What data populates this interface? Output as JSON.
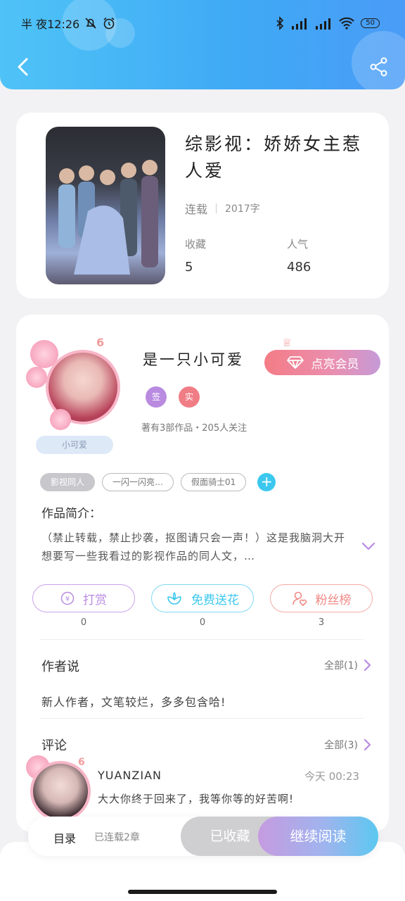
{
  "status_bar": {
    "time": "半 夜12:26",
    "battery": "50"
  },
  "book": {
    "title": "综影视：娇娇女主惹人爱",
    "status": "连载",
    "word_count": "2017字",
    "favorites_label": "收藏",
    "favorites_value": "5",
    "popularity_label": "人气",
    "popularity_value": "486"
  },
  "author": {
    "level": "6",
    "name": "是一只小可爱",
    "nickname_pill": "小可爱",
    "vip_button": "点亮会员",
    "badges": [
      {
        "label": "签",
        "color": "#b98be0"
      },
      {
        "label": "实",
        "color": "#f07d86"
      }
    ],
    "meta": "著有3部作品・205人关注"
  },
  "tags": [
    "影视同人",
    "一闪一闪亮…",
    "假面骑士01"
  ],
  "intro": {
    "label": "作品简介：",
    "text": "（禁止转载，禁止抄袭，抠图请只会一声！）这是我脑洞大开想要写一些我看过的影视作品的同人文，…"
  },
  "actions": [
    {
      "label": "打赏",
      "count": "0",
      "color": "#b98be0"
    },
    {
      "label": "免费送花",
      "count": "0",
      "color": "#3cc8ee"
    },
    {
      "label": "粉丝榜",
      "count": "3",
      "color": "#f08a86"
    }
  ],
  "author_say": {
    "title": "作者说",
    "more": "全部(1)",
    "text": "新人作者，文笔较烂，多多包含哈!"
  },
  "comments": {
    "title": "评论",
    "more": "全部(3)",
    "items": [
      {
        "level": "6",
        "user": "YUANZIAN",
        "time": "今天 00:23",
        "text": "大大你终于回来了，我等你等的好苦啊!"
      }
    ]
  },
  "bottom_bar": {
    "toc": "目录",
    "chapters": "已连载2章",
    "favorited": "已收藏",
    "continue": "继续阅读"
  },
  "colors": {
    "header": "#3fa9f5",
    "accent_purple": "#b98be0",
    "accent_cyan": "#3cc8ee",
    "accent_pink": "#f08a86"
  }
}
